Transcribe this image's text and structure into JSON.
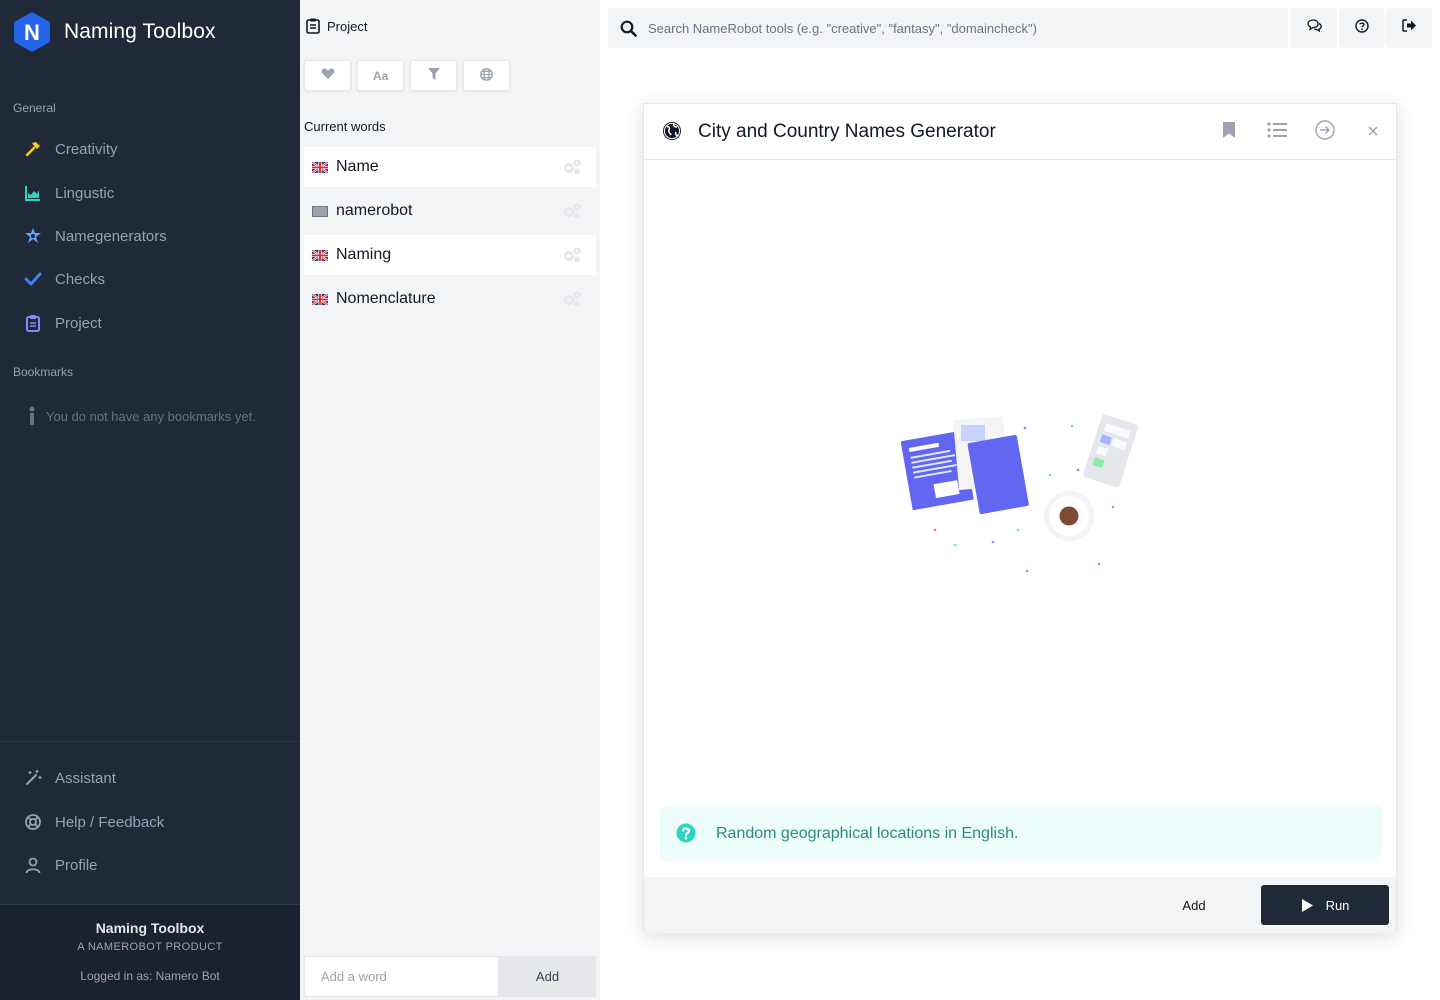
{
  "brand": {
    "logo_letter": "N",
    "title": "Naming Toolbox"
  },
  "sidebar": {
    "general_label": "General",
    "items": [
      {
        "label": "Creativity",
        "icon": "hammer-icon",
        "color": "#facc15"
      },
      {
        "label": "Lingustic",
        "icon": "chart-icon",
        "color": "#2dd4bf"
      },
      {
        "label": "Namegenerators",
        "icon": "star-badge-icon",
        "color": "#60a5fa"
      },
      {
        "label": "Checks",
        "icon": "check-icon",
        "color": "#3b82f6"
      },
      {
        "label": "Project",
        "icon": "clipboard-icon",
        "color": "#818cf8"
      }
    ],
    "bookmarks_label": "Bookmarks",
    "bookmarks_empty": "You do not have any bookmarks yet.",
    "bottom_items": [
      {
        "label": "Assistant",
        "icon": "magic-wand-icon"
      },
      {
        "label": "Help / Feedback",
        "icon": "lifebuoy-icon"
      },
      {
        "label": "Profile",
        "icon": "user-icon"
      }
    ],
    "footer": {
      "title": "Naming Toolbox",
      "subtitle": "A NAMEROBOT PRODUCT",
      "logged_in": "Logged in as: Namero Bot"
    }
  },
  "project": {
    "title": "Project",
    "toolbar": [
      {
        "icon": "heart-icon"
      },
      {
        "icon": "font-icon",
        "text": "Aa"
      },
      {
        "icon": "filter-icon"
      },
      {
        "icon": "globe-icon"
      }
    ],
    "current_words_label": "Current words",
    "words": [
      {
        "text": "Name",
        "flag": "uk-flag"
      },
      {
        "text": "namerobot",
        "flag": "neutral-flag"
      },
      {
        "text": "Naming",
        "flag": "uk-flag"
      },
      {
        "text": "Nomenclature",
        "flag": "uk-flag"
      }
    ],
    "add_placeholder": "Add a word",
    "add_button": "Add"
  },
  "search": {
    "placeholder": "Search NameRobot tools (e.g. \"creative\", \"fantasy\", \"domaincheck\")"
  },
  "top_buttons": [
    {
      "icon": "chat-icon"
    },
    {
      "icon": "help-circle-icon"
    },
    {
      "icon": "logout-icon"
    }
  ],
  "modal": {
    "title": "City and Country Names Generator",
    "icon": "globe-icon",
    "actions": [
      {
        "icon": "bookmark-icon"
      },
      {
        "icon": "list-icon"
      },
      {
        "icon": "arrow-right-circle-icon"
      },
      {
        "icon": "close-icon"
      }
    ],
    "description": "Random geographical locations in English.",
    "add_button": "Add",
    "run_button": "Run"
  }
}
